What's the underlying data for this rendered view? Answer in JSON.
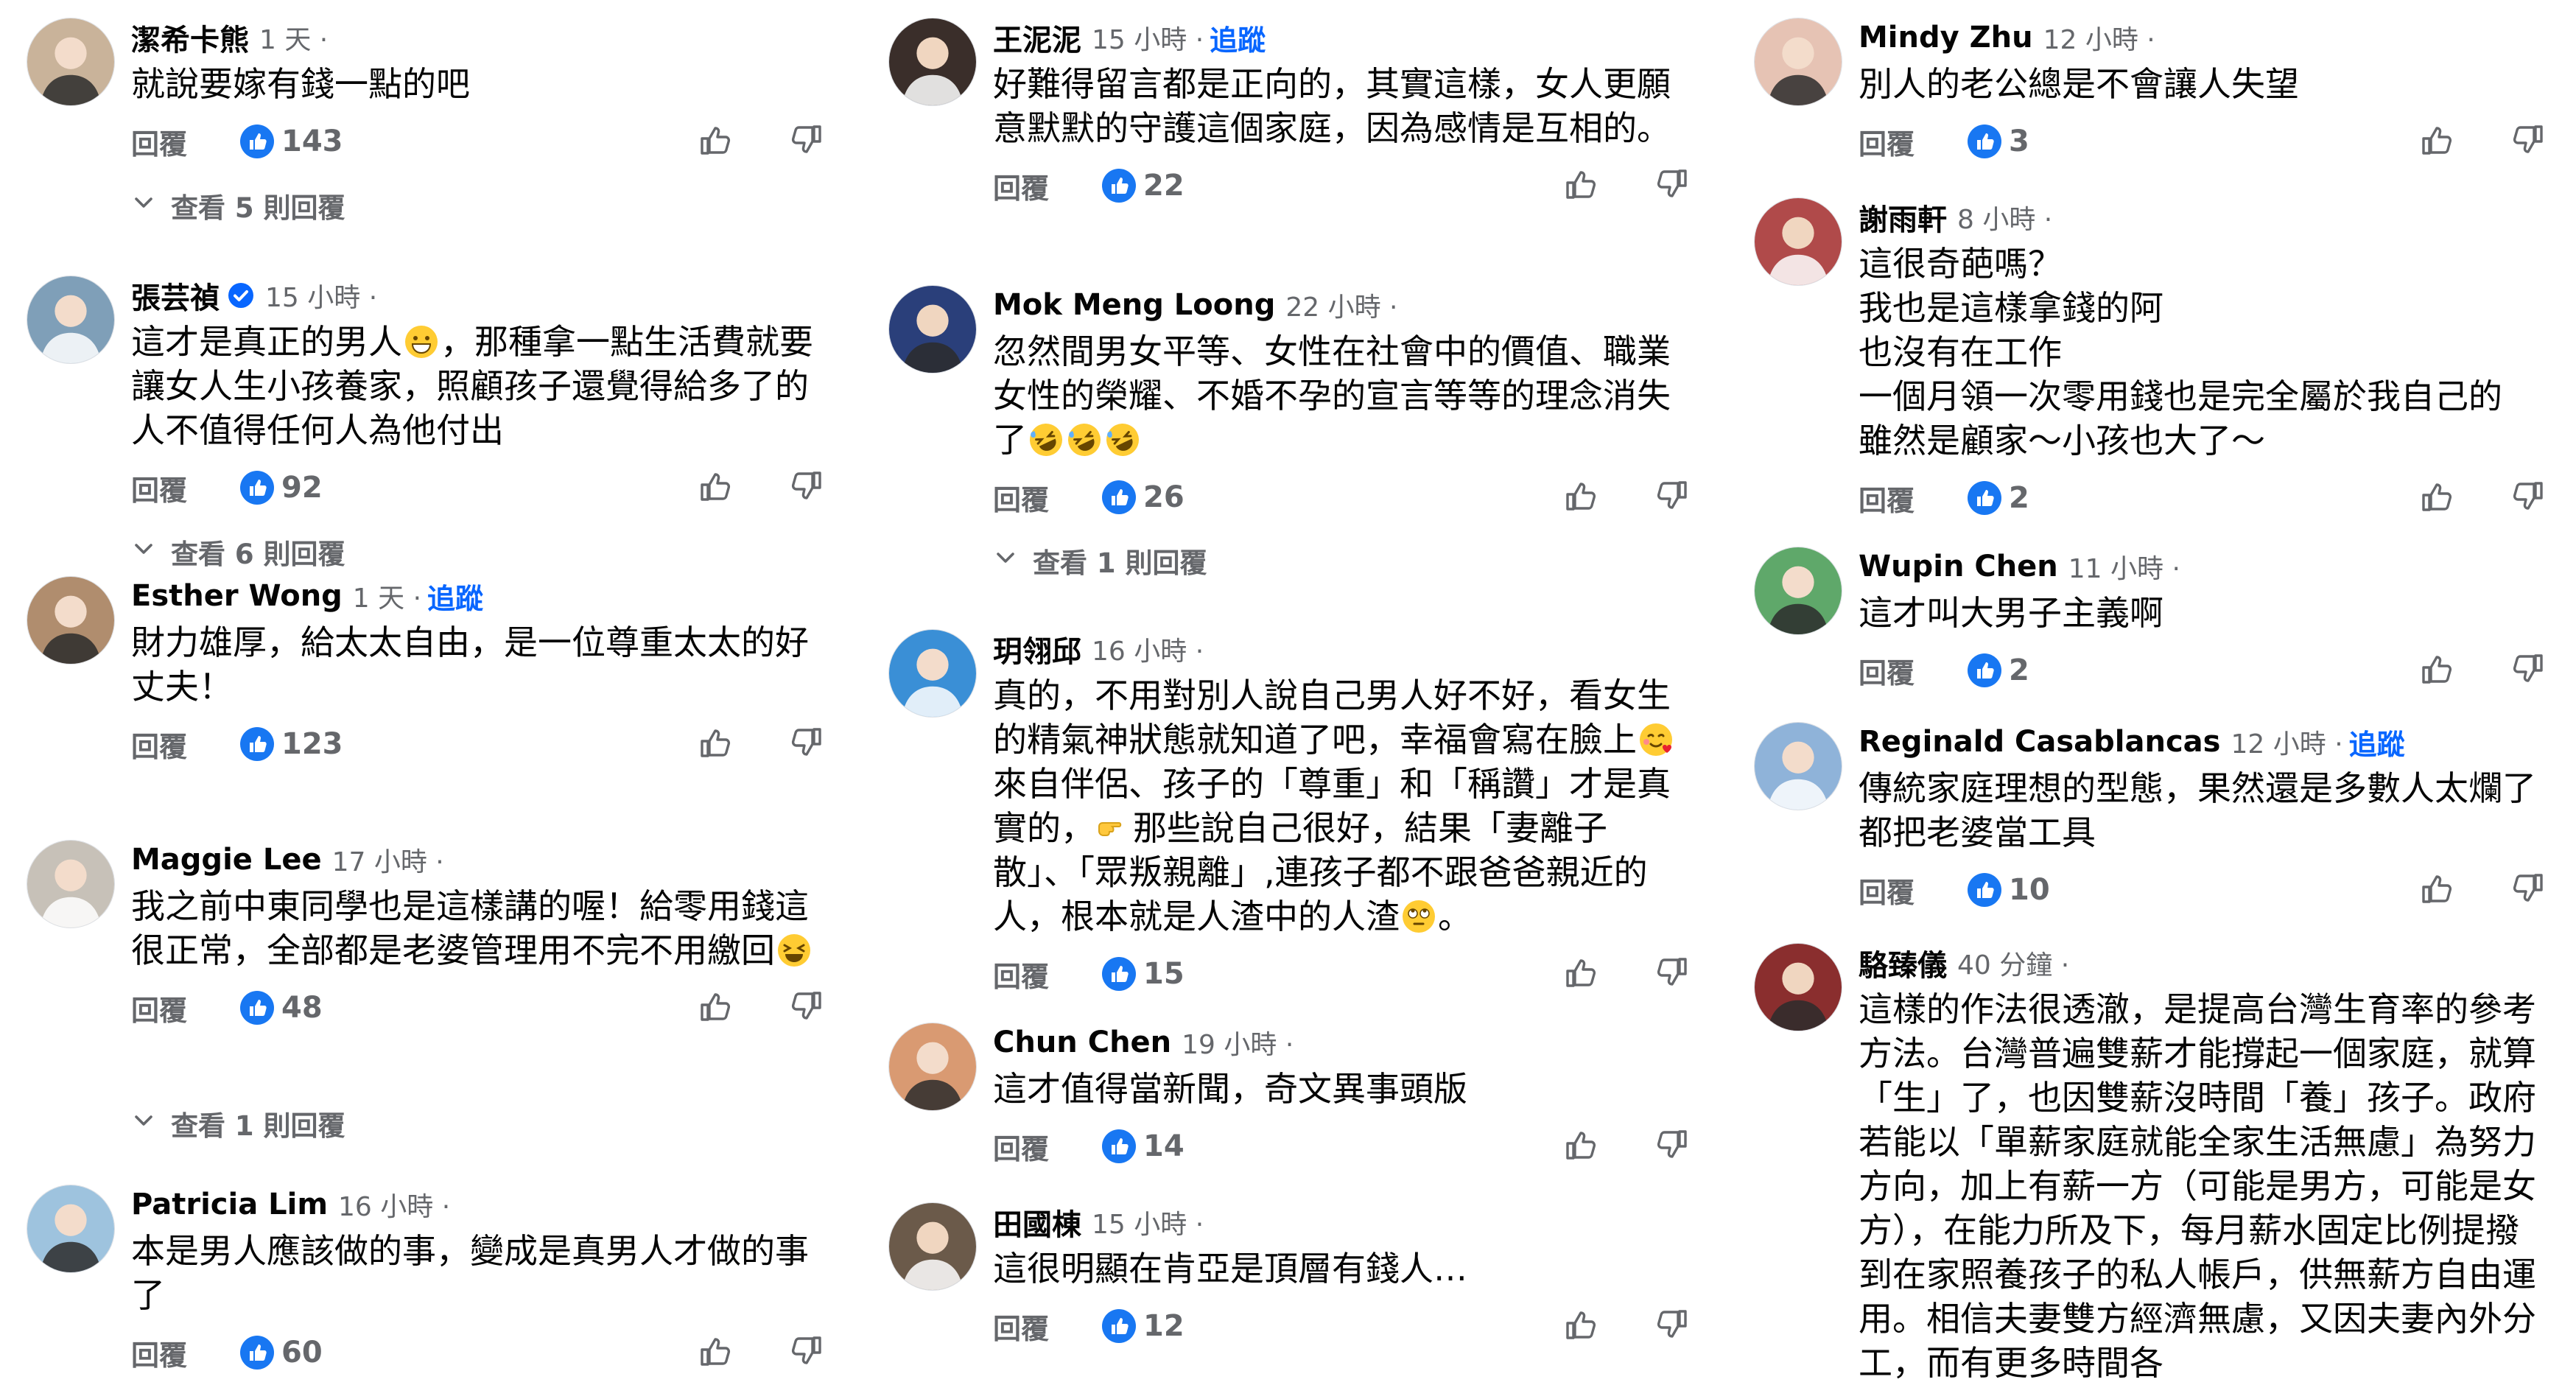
{
  "ui": {
    "reply_label": "回覆"
  },
  "columns": [
    {
      "comments": [
        {
          "name": "潔希卡熊",
          "time": "1 天",
          "text": [
            "就說要嫁有錢一點的吧"
          ],
          "likes": "143",
          "replies": "查看 5 則回覆"
        },
        {
          "name": "張芸禎",
          "verified": true,
          "time": "15 小時",
          "text": [
            "這才是真正的男人",
            "，那種拿一點生活費就要讓女人生小孩養家，照顧孩子還覺得給多了的人不值得任何人為他付出"
          ],
          "emoji": "grin",
          "likes": "92",
          "replies": "查看 6 則回覆"
        },
        {
          "name": "Esther Wong",
          "time": "1 天",
          "follow": "追蹤",
          "text": [
            "財力雄厚，給太太自由，是一位尊重太太的好丈夫！"
          ],
          "likes": "123"
        },
        {
          "name": "Maggie Lee",
          "time": "17 小時",
          "text": [
            "我之前中東同學也是這樣講的喔！給零用錢這很正常，全部都是老婆管理用不完不用繳回"
          ],
          "emoji_end": "laugh",
          "likes": "48",
          "replies": "查看 1 則回覆"
        },
        {
          "name": "Patricia Lim",
          "time": "16 小時",
          "text": [
            "本是男人應該做的事，變成是真男人才做的事了"
          ],
          "likes": "60"
        }
      ]
    },
    {
      "comments": [
        {
          "name": "王泥泥",
          "time": "15 小時",
          "follow": "追蹤",
          "text": [
            "好難得留言都是正向的，其實這樣，女人更願意默默的守護這個家庭，因為感情是互相的。"
          ],
          "likes": "22"
        },
        {
          "name": "Mok Meng Loong",
          "time": "22 小時",
          "text": [
            "忽然間男女平等、女性在社會中的價值、職業女性的榮耀、不婚不孕的宣言等等的理念消失了"
          ],
          "emoji_end": "rofl3",
          "likes": "26",
          "replies": "查看 1 則回覆"
        },
        {
          "name": "玥翎邱",
          "time": "16 小時",
          "text": [
            "真的，不用對別人說自己男人好不好，看女生的精氣神狀態就知道了吧，幸福會寫在臉上",
            "來自伴侶、孩子的「尊重」和「稱讚」才是真實的，",
            "那些說自己很好，結果「妻離子散」、「眾叛親離」,連孩子都不跟爸爸親近的人，根本就是人渣中的人渣",
            "。"
          ],
          "likes": "15"
        },
        {
          "name": "Chun Chen",
          "time": "19 小時",
          "text": [
            "這才值得當新聞，奇文異事頭版"
          ],
          "likes": "14"
        },
        {
          "name": "田國棟",
          "time": "15 小時",
          "text": [
            "這很明顯在肯亞是頂層有錢人…"
          ],
          "likes": "12"
        }
      ]
    },
    {
      "comments": [
        {
          "name": "Mindy Zhu",
          "time": "12 小時",
          "text": [
            "別人的老公總是不會讓人失望"
          ],
          "likes": "3"
        },
        {
          "name": "謝雨軒",
          "time": "8 小時",
          "text": [
            "這很奇葩嗎？",
            "我也是這樣拿錢的阿",
            "也沒有在工作",
            "一個月領一次零用錢也是完全屬於我自己的",
            "雖然是顧家～小孩也大了～"
          ],
          "likes": "2"
        },
        {
          "name": "Wupin Chen",
          "time": "11 小時",
          "text": [
            "這才叫大男子主義啊"
          ],
          "likes": "2"
        },
        {
          "name": "Reginald Casablancas",
          "time": "12 小時",
          "follow": "追蹤",
          "text": [
            "傳統家庭理想的型態，果然還是多數人太爛了都把老婆當工具"
          ],
          "likes": "10"
        },
        {
          "name": "駱臻儀",
          "time": "40 分鐘",
          "text": [
            "這樣的作法很透澈，是提高台灣生育率的參考方法。台灣普遍雙薪才能撐起一個家庭，就算「生」了，也因雙薪沒時間「養」孩子。政府若能以「單薪家庭就能全家生活無慮」為努力方向，加上有薪一方（可能是男方，可能是女方），在能力所及下，每月薪水固定比例提撥到在家照養孩子的私人帳戶，供無薪方自由運用。相信夫妻雙方經濟無慮，又因夫妻內外分工，而有更多時間各"
          ]
        }
      ]
    }
  ],
  "avatar_colors": [
    "#c9b39a",
    "#7f9fb8",
    "#b08d6e",
    "#c7c1b8",
    "#9ec3de",
    "#3a2e2a",
    "#2a3f7a",
    "#3a8fd6",
    "#d99a72",
    "#6b5a4a",
    "#e6c3b4",
    "#b04a4a",
    "#5fa86a",
    "#8fb3d9",
    "#8a2e2e"
  ]
}
